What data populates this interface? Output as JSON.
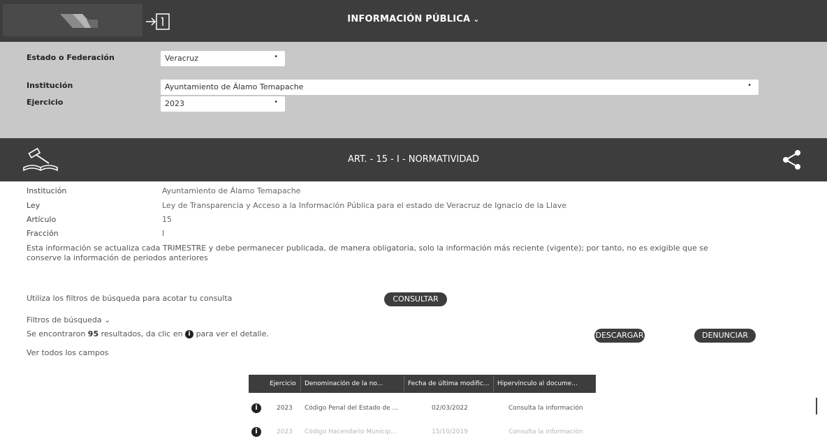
{
  "header": {
    "title": "INFORMACIÓN PÚBLICA"
  },
  "filters": {
    "estado_label": "Estado o Federación",
    "estado_value": "Veracruz",
    "institucion_label": "Institución",
    "institucion_value": "Ayuntamiento de Álamo Temapache",
    "ejercicio_label": "Ejercicio",
    "ejercicio_value": "2023"
  },
  "article": {
    "title": "ART. - 15 - I - NORMATIVIDAD"
  },
  "details": {
    "institucion_label": "Institución",
    "institucion_value": "Ayuntamiento de Álamo Temapache",
    "ley_label": "Ley",
    "ley_value": "Ley de Transparencia y Acceso a la Información Pública para el estado de Veracruz de Ignacio de la Llave",
    "articulo_label": "Artículo",
    "articulo_value": "15",
    "fraccion_label": "Fracción",
    "fraccion_value": "I",
    "note": "Esta información se actualiza cada TRIMESTRE y debe permanecer publicada, de manera obligatoria, solo la información más reciente (vigente); por tanto, no es exigible que se conserve la información de periodos anteriores"
  },
  "search": {
    "hint": "Utiliza los filtros de búsqueda para acotar tu consulta",
    "consult_label": "CONSULTAR",
    "filters_toggle": "Filtros de búsqueda"
  },
  "results": {
    "prefix": "Se encontraron",
    "count": "95",
    "middle": "resultados, da clic en",
    "suffix": "para ver el detalle.",
    "download_label": "DESCARGAR",
    "report_label": "DENUNCIAR",
    "see_all": "Ver todos los campos"
  },
  "table": {
    "columns": [
      "Ejercicio",
      "Denominación de la no...",
      "Fecha de última modific...",
      "Hipervínculo al docume..."
    ],
    "rows": [
      {
        "ejercicio": "2023",
        "denominacion": "Código Penal del Estado de ...",
        "fecha": "02/03/2022",
        "hipervinculo": "Consulta la información"
      },
      {
        "ejercicio": "2023",
        "denominacion": "Código Hacendario Municip...",
        "fecha": "15/10/2019",
        "hipervinculo": "Consulta la información"
      }
    ]
  },
  "icons": {
    "logo": "logo-icon",
    "login": "login-icon",
    "law": "law-gavel-book-icon",
    "share": "share-icon",
    "info": "info-icon"
  },
  "colors": {
    "dark_bar": "#3d3d3d",
    "filter_bg": "#c8c8c8"
  }
}
